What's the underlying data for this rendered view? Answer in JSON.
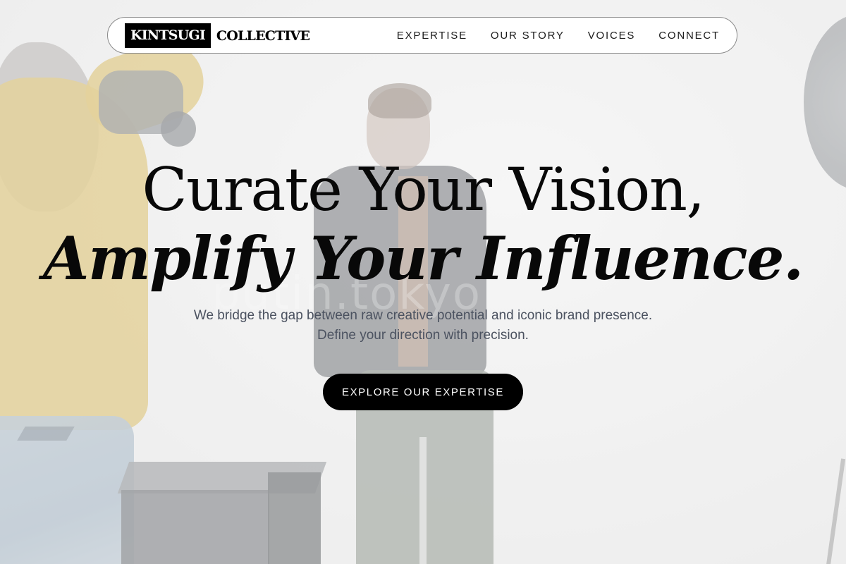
{
  "header": {
    "brand_mark": "KINTSUGI",
    "brand_word": "COLLECTIVE",
    "nav": [
      {
        "label": "EXPERTISE"
      },
      {
        "label": "OUR STORY"
      },
      {
        "label": "VOICES"
      },
      {
        "label": "CONNECT"
      }
    ]
  },
  "hero": {
    "headline_line1": "Curate Your Vision,",
    "headline_line2": "Amplify Your Influence.",
    "subtitle": "We bridge the gap between raw creative potential and iconic brand presence. Define your direction with precision.",
    "cta_label": "EXPLORE OUR EXPERTISE",
    "background_watermark": "putin.tokyo"
  },
  "colors": {
    "text": "#080808",
    "subtitle": "#4b5260",
    "button_bg": "#000000",
    "button_text": "#ffffff",
    "nav_bg": "#ffffff"
  }
}
